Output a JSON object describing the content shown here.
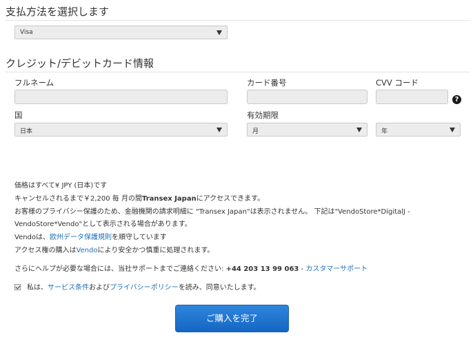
{
  "payment_method": {
    "title": "支払方法を選択します",
    "selected": "Visa"
  },
  "card_info": {
    "title": "クレジット/デビットカード情報",
    "full_name_label": "フルネーム",
    "full_name_value": "",
    "card_number_label": "カード番号",
    "card_number_value": "",
    "cvv_label": "CVV コード",
    "cvv_value": "",
    "help_icon": "?",
    "country_label": "国",
    "country_selected": "日本",
    "expiry_label": "有効期限",
    "expiry_month": "月",
    "expiry_year": "年"
  },
  "info": {
    "line1": "価格はすべて¥ JPY (日本)です",
    "line2_pre": "キャンセルされるまで￥2,200 毎 月の間",
    "line2_bold": "Transex Japan",
    "line2_post": "にアクセスできます。",
    "line3": "お客様のプライバシー保護のため、金融機関の請求明細に \"Transex Japan\"は表示されません。 下記は\"VendoStore*DigitalJ -",
    "line4": "VendoStore*Vendo\"として表示される場合があります。",
    "line5_pre": "Vendoは、",
    "line5_link": "欧州データ保護規則",
    "line5_post": "を順守しています",
    "line6_pre": "アクセス権の購入は",
    "line6_link": "Vendo",
    "line6_post": "により安全かつ慎重に処理されます。",
    "help_pre": "さらにヘルプが必要な場合には、当社サポートまでご連絡ください: ",
    "help_phone": "+44 203 13 99 063",
    "help_sep": " - ",
    "help_link": "カスタマーサポート"
  },
  "agreement": {
    "checked": true,
    "pre": "私は、",
    "terms_link": "サービス条件",
    "mid": "および",
    "privacy_link": "プライバシーポリシー",
    "post": "を読み、同意いたします。"
  },
  "submit_label": "ご購入を完了",
  "colors": {
    "link": "#1d6fb8",
    "button": "#1d70c8",
    "field_bg": "#ececec"
  }
}
